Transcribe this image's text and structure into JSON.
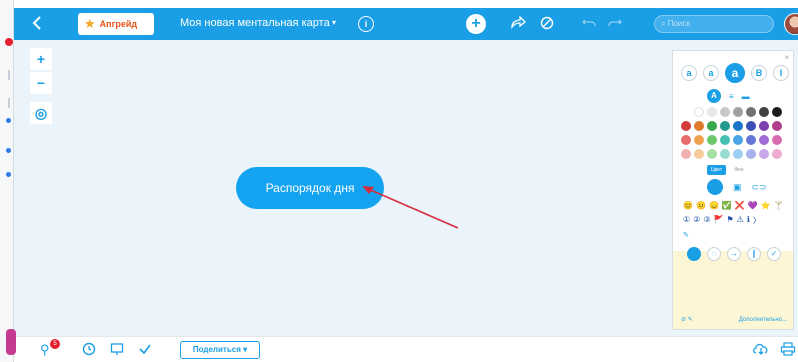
{
  "topbar": {
    "back_icon": "chevron-left-icon",
    "upgrade_label": "Апгрейд",
    "map_title": "Моя новая ментальная карта",
    "title_caret": "▾",
    "info_label": "i",
    "add_label": "+",
    "search_placeholder": "Поиск"
  },
  "canvas": {
    "zoom_in": "+",
    "zoom_out": "−",
    "center_label": "◎",
    "node_text": "Распорядок дня"
  },
  "panel": {
    "close_label": "×",
    "text_sizes": [
      "a",
      "a",
      "a",
      "B",
      "I"
    ],
    "tabs": [
      "Цвет",
      "Фон"
    ],
    "emoji_row1": [
      "😊",
      "😐",
      "😞",
      "✅",
      "❌",
      "💜",
      "⭐",
      "🍸"
    ],
    "emoji_row2": [
      "①",
      "②",
      "③",
      "🚩",
      "⚑",
      "⚠",
      "ℹ",
      "〉"
    ],
    "more_label": "Дополнительно...",
    "colors_row1": [
      "#ffffff",
      "#e8e8e8",
      "#c8c8c8",
      "#a0a0a0",
      "#707070",
      "#404040",
      "#1c1c1c"
    ],
    "colors_row2": [
      "#d23b3b",
      "#e07a2c",
      "#3aa84a",
      "#1f9a8c",
      "#1a76c8",
      "#3b4fb5",
      "#7b3fb0",
      "#b03f8a"
    ],
    "colors_row3": [
      "#e96a6a",
      "#f2a14f",
      "#6cc86a",
      "#44c0b0",
      "#4aa4e6",
      "#6676d6",
      "#a06bd6",
      "#d86ab0"
    ],
    "colors_row4": [
      "#f3b0b0",
      "#f7cc9a",
      "#a8e0a4",
      "#98dcd2",
      "#9ccdf2",
      "#a8b2ea",
      "#caa8ea",
      "#eeaad2"
    ]
  },
  "bottombar": {
    "badge_count": "5",
    "share_label": "Поделиться ▾"
  }
}
